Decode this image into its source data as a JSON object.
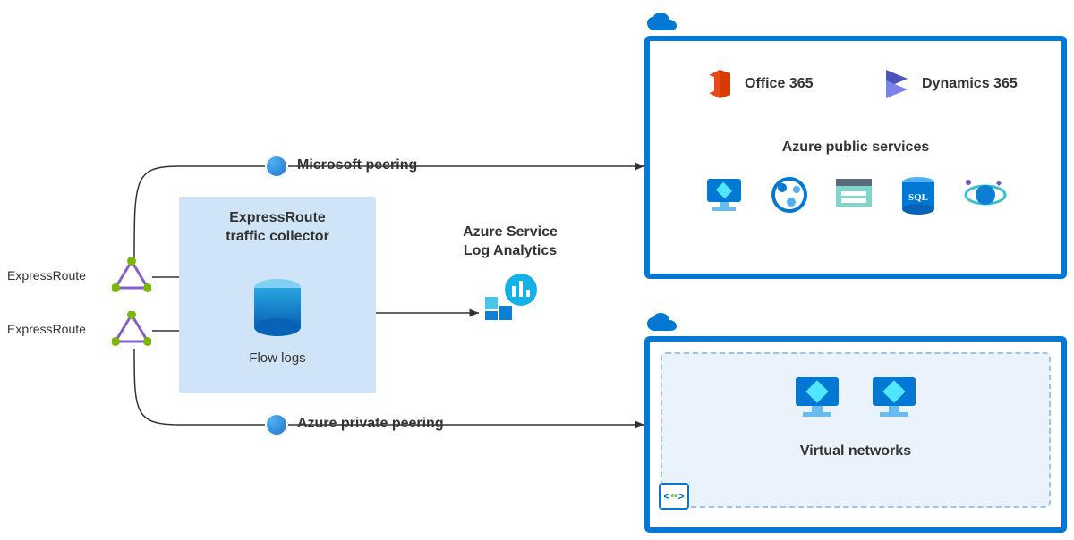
{
  "left": {
    "circuit1_label": "ExpressRoute",
    "circuit2_label": "ExpressRoute"
  },
  "collector": {
    "title_line1": "ExpressRoute",
    "title_line2": "traffic collector",
    "flow_label": "Flow logs"
  },
  "log_analytics": {
    "title_line1": "Azure Service",
    "title_line2": "Log Analytics"
  },
  "peering": {
    "microsoft_label": "Microsoft peering",
    "private_label": "Azure private peering"
  },
  "public_cloud": {
    "office_label": "Office 365",
    "dynamics_label": "Dynamics 365",
    "subheading": "Azure public services",
    "services": [
      {
        "name": "virtual-machine-icon",
        "color": "#0078d4"
      },
      {
        "name": "web-app-icon",
        "color": "#0078d4"
      },
      {
        "name": "storage-icon",
        "color": "#3ebeb0"
      },
      {
        "name": "sql-database-icon",
        "glyph": "SQL",
        "color": "#0078d4"
      },
      {
        "name": "cosmos-db-icon",
        "color": "#3ebeb0"
      }
    ]
  },
  "private_cloud": {
    "subheading": "Virtual networks"
  }
}
